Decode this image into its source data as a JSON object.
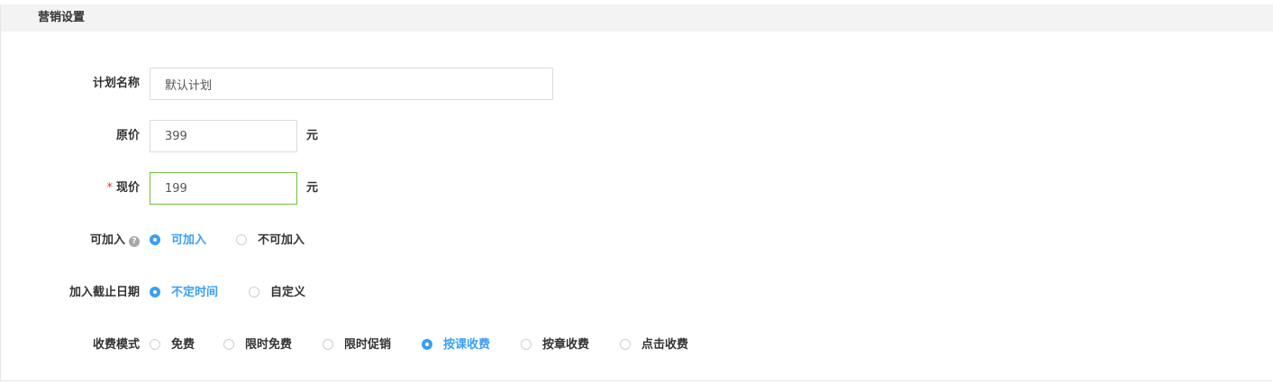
{
  "section": {
    "title": "营销设置"
  },
  "form": {
    "plan_name": {
      "label": "计划名称",
      "value": "默认计划"
    },
    "original_price": {
      "label": "原价",
      "value": "399",
      "unit": "元"
    },
    "current_price": {
      "required_mark": "*",
      "label": "现价",
      "value": "199",
      "unit": "元"
    },
    "joinable": {
      "label": "可加入",
      "help_icon": "?",
      "options": [
        "可加入",
        "不可加入"
      ],
      "selected": "可加入"
    },
    "join_deadline": {
      "label": "加入截止日期",
      "options": [
        "不定时间",
        "自定义"
      ],
      "selected": "不定时间"
    },
    "fee_mode": {
      "label": "收费模式",
      "options": [
        "免费",
        "限时免费",
        "限时促销",
        "按课收费",
        "按章收费",
        "点击收费"
      ],
      "selected": "按课收费"
    }
  },
  "colors": {
    "accent": "#3a9ff5",
    "required": "#e4393c",
    "focus_border": "#6fbf3f",
    "header_bg": "#f3f3f3"
  }
}
